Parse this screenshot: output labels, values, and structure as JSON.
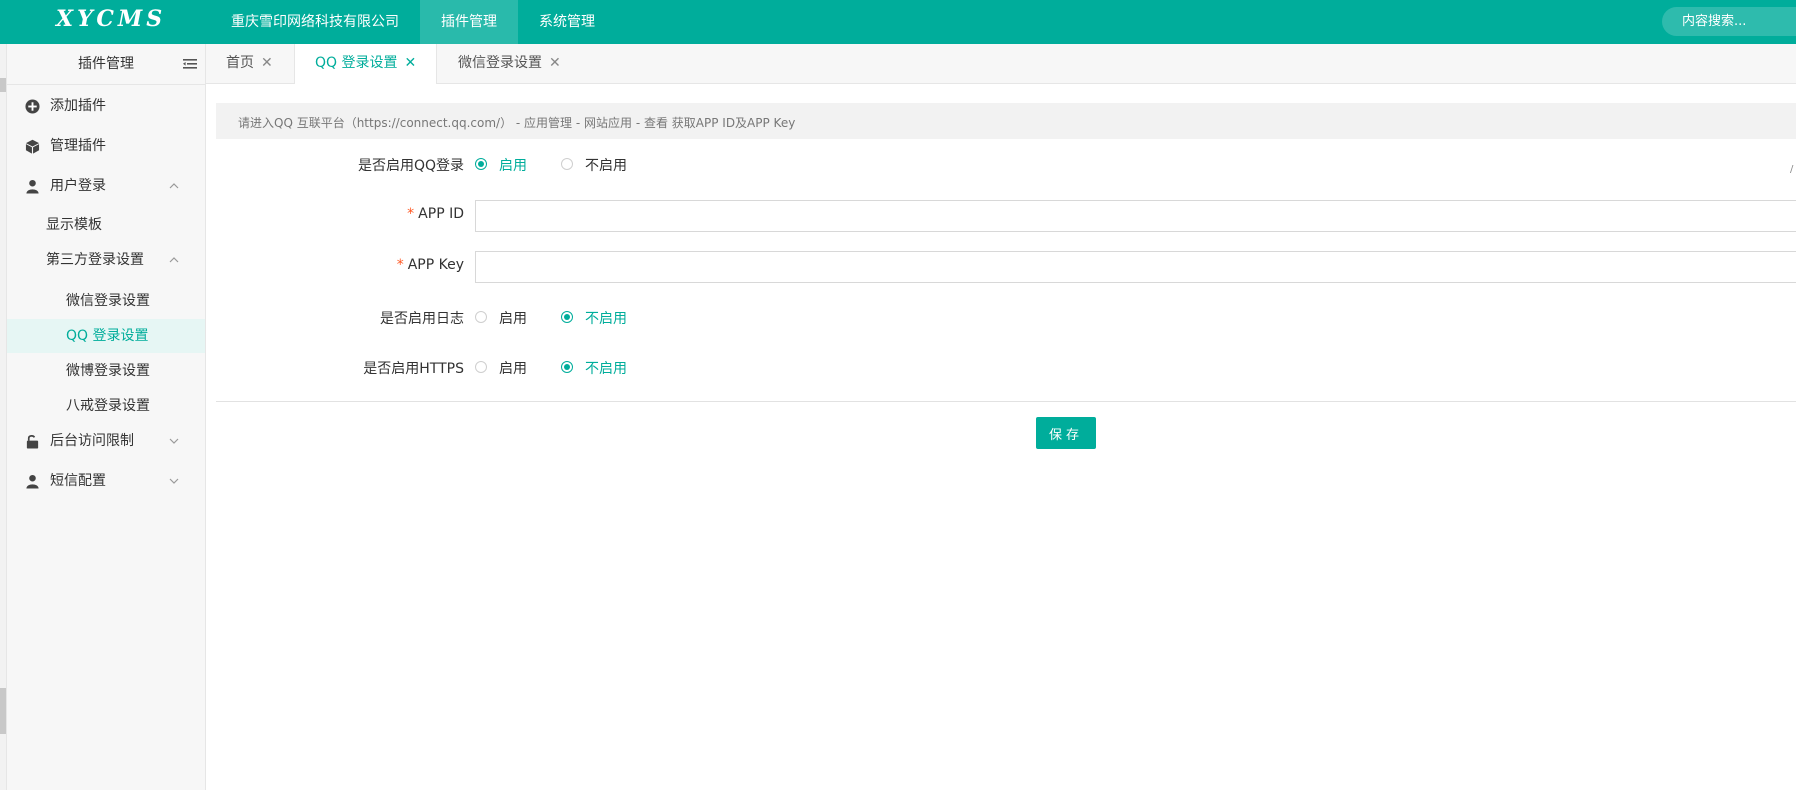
{
  "app": {
    "logo": "XYCMS",
    "top_nav": [
      {
        "label": "重庆雪印网络科技有限公司"
      },
      {
        "label": "插件管理"
      },
      {
        "label": "系统管理"
      }
    ],
    "search_placeholder": "内容搜索..."
  },
  "sidebar": {
    "title": "插件管理",
    "items": [
      {
        "label": "添加插件",
        "icon": "plus-circle-icon"
      },
      {
        "label": "管理插件",
        "icon": "cube-icon"
      },
      {
        "label": "用户登录",
        "icon": "user-icon"
      },
      {
        "label": "显示模板"
      },
      {
        "label": "第三方登录设置"
      },
      {
        "label": "微信登录设置"
      },
      {
        "label": "QQ 登录设置"
      },
      {
        "label": "微博登录设置"
      },
      {
        "label": "八戒登录设置"
      },
      {
        "label": "后台访问限制",
        "icon": "unlock-icon"
      },
      {
        "label": "短信配置",
        "icon": "user-icon"
      }
    ]
  },
  "tabs": [
    {
      "label": "首页"
    },
    {
      "label": "QQ 登录设置"
    },
    {
      "label": "微信登录设置"
    }
  ],
  "notice": "请进入QQ 互联平台（https://connect.qq.com/） - 应用管理 - 网站应用 - 查看 获取APP ID及APP Key",
  "form": {
    "enable_qq": {
      "label": "是否启用QQ登录",
      "options": [
        "启用",
        "不启用"
      ],
      "selected": "启用"
    },
    "app_id": {
      "label": "APP ID",
      "value": ""
    },
    "app_key": {
      "label": "APP Key",
      "value": ""
    },
    "enable_log": {
      "label": "是否启用日志",
      "options": [
        "启用",
        "不启用"
      ],
      "selected": "不启用"
    },
    "enable_https": {
      "label": "是否启用HTTPS",
      "options": [
        "启用",
        "不启用"
      ],
      "selected": "不启用"
    },
    "required_mark": "*",
    "save_label": "保存"
  },
  "colors": {
    "accent": "#00ad9b",
    "sidebar_bg": "#f7f7f7",
    "active_bg": "#e6f6f4"
  }
}
